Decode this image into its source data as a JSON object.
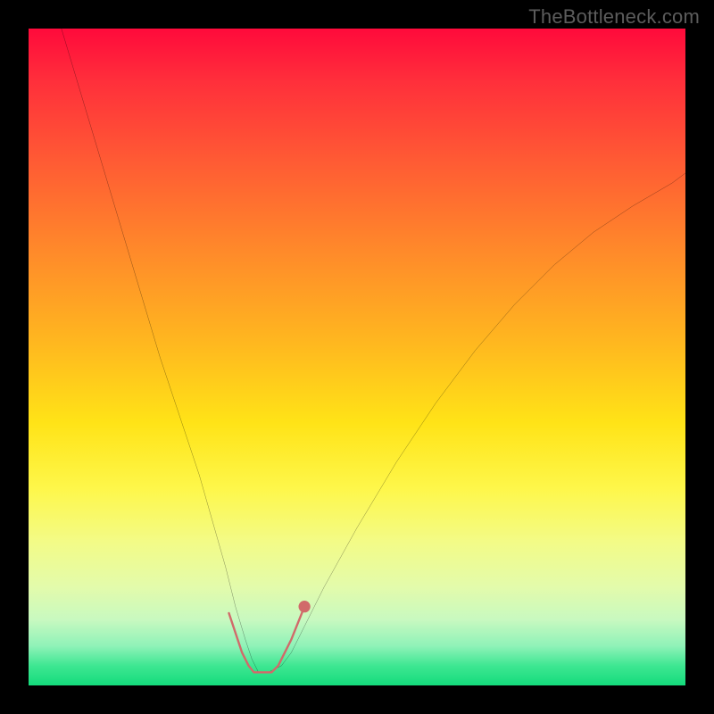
{
  "watermark": "TheBottleneck.com",
  "chart_data": {
    "type": "line",
    "title": "",
    "xlabel": "",
    "ylabel": "",
    "xlim": [
      0,
      100
    ],
    "ylim": [
      0,
      100
    ],
    "grid": false,
    "series": [
      {
        "name": "curve",
        "stroke": "#000000",
        "stroke_width": 1.6,
        "x": [
          5,
          8,
          11,
          14,
          17,
          20,
          23,
          26,
          28,
          30,
          31.5,
          33,
          34,
          35,
          36.5,
          38.5,
          40,
          42,
          45,
          50,
          56,
          62,
          68,
          74,
          80,
          86,
          92,
          98,
          100
        ],
        "y": [
          100,
          90,
          80,
          70,
          60,
          50,
          41,
          32,
          25,
          18,
          12,
          7,
          4,
          2,
          2,
          3,
          5,
          9,
          15,
          24,
          34,
          43,
          51,
          58,
          64,
          69,
          73,
          76.5,
          78
        ]
      },
      {
        "name": "markers",
        "type": "scatter",
        "stroke": "#d16a6a",
        "points": [
          {
            "x": 30.5,
            "y": 11
          },
          {
            "x": 31.5,
            "y": 8
          },
          {
            "x": 32.5,
            "y": 5
          },
          {
            "x": 33.5,
            "y": 3
          },
          {
            "x": 34.3,
            "y": 2
          },
          {
            "x": 35.2,
            "y": 2
          },
          {
            "x": 36.1,
            "y": 2
          },
          {
            "x": 37.0,
            "y": 2
          },
          {
            "x": 38.0,
            "y": 3
          },
          {
            "x": 39.0,
            "y": 5
          },
          {
            "x": 40.0,
            "y": 7
          },
          {
            "x": 42.0,
            "y": 12
          }
        ]
      }
    ],
    "gradient_stops": [
      {
        "pos": 0,
        "color": "#ff0a3b"
      },
      {
        "pos": 8,
        "color": "#ff2f3b"
      },
      {
        "pos": 20,
        "color": "#ff5a34"
      },
      {
        "pos": 34,
        "color": "#ff8a2a"
      },
      {
        "pos": 48,
        "color": "#ffb81f"
      },
      {
        "pos": 60,
        "color": "#ffe317"
      },
      {
        "pos": 70,
        "color": "#fef74a"
      },
      {
        "pos": 78,
        "color": "#f3fb86"
      },
      {
        "pos": 85,
        "color": "#e3fbab"
      },
      {
        "pos": 90,
        "color": "#c8f9c0"
      },
      {
        "pos": 94,
        "color": "#8ff2b8"
      },
      {
        "pos": 97,
        "color": "#3ee792"
      },
      {
        "pos": 100,
        "color": "#14db7c"
      }
    ]
  }
}
